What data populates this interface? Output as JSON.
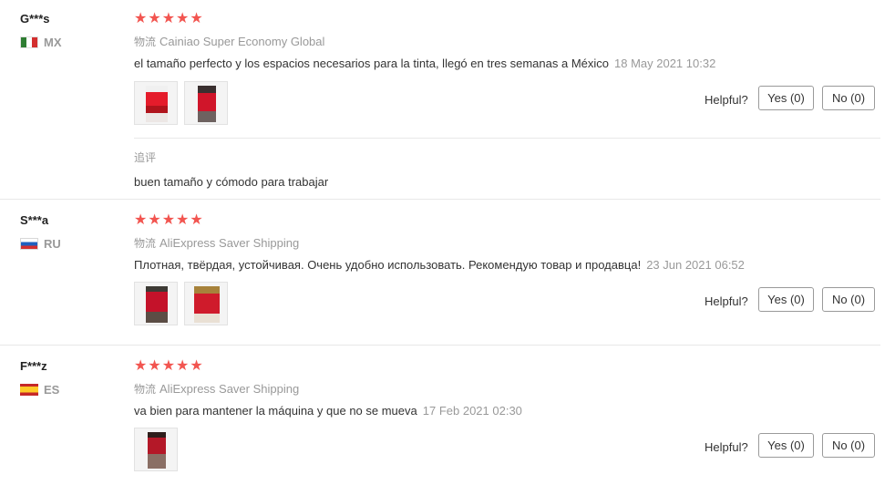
{
  "helpful_label": "Helpful?",
  "star_color": "#f25550",
  "reviews": [
    {
      "user": "G***s",
      "country": "MX",
      "flag_icon": "mexico-flag-icon",
      "stars": 5,
      "shipping_tag": "物流",
      "shipping": "Cainiao Super Economy Global",
      "text": "el tamaño perfecto y los espacios necesarios para la tinta, llegó en tres semanas a México",
      "date": "18 May 2021 10:32",
      "yes": "Yes (0)",
      "no": "No (0)",
      "followup_label": "追评",
      "followup_text": "buen tamaño y cómodo para trabajar"
    },
    {
      "user": "S***a",
      "country": "RU",
      "flag_icon": "russia-flag-icon",
      "stars": 5,
      "shipping_tag": "物流",
      "shipping": "AliExpress Saver Shipping",
      "text": "Плотная, твёрдая, устойчивая. Очень удобно использовать. Рекомендую товар и продавца!",
      "date": "23 Jun 2021 06:52",
      "yes": "Yes (0)",
      "no": "No (0)"
    },
    {
      "user": "F***z",
      "country": "ES",
      "flag_icon": "spain-flag-icon",
      "stars": 5,
      "shipping_tag": "物流",
      "shipping": "AliExpress Saver Shipping",
      "text": "va bien para mantener la máquina y que no se mueva",
      "date": "17 Feb 2021 02:30",
      "yes": "Yes (0)",
      "no": "No (0)"
    }
  ]
}
